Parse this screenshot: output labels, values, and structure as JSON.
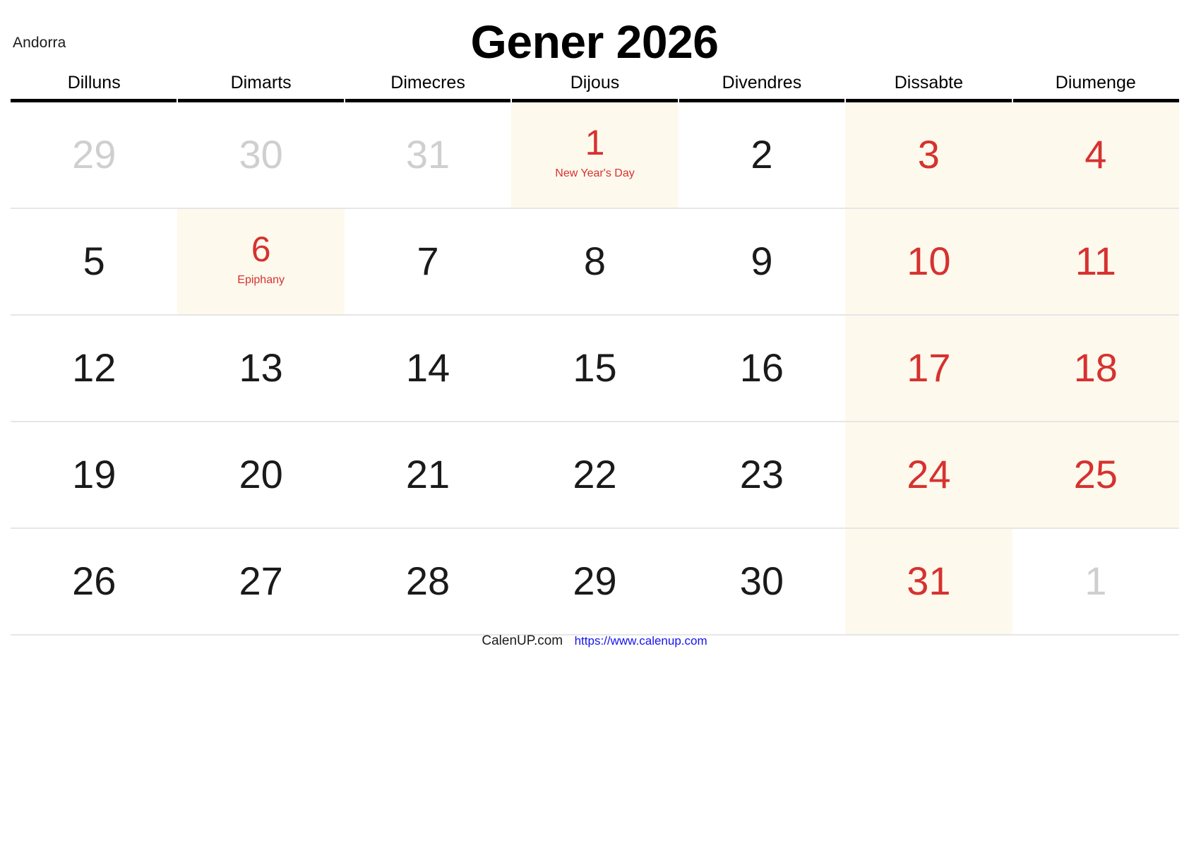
{
  "header": {
    "country": "Andorra",
    "title": "Gener 2026"
  },
  "weekdays": [
    "Dilluns",
    "Dimarts",
    "Dimecres",
    "Dijous",
    "Divendres",
    "Dissabte",
    "Diumenge"
  ],
  "colors": {
    "holiday_text": "#d63230",
    "weekend_background": "#fdf9ed",
    "muted_day": "#cfcfcf",
    "link": "#1414ee",
    "header_rule": "#000000",
    "row_rule": "#e6e6e6"
  },
  "weeks": [
    [
      {
        "num": "29",
        "style": "muted",
        "bg": "none",
        "event": ""
      },
      {
        "num": "30",
        "style": "muted",
        "bg": "none",
        "event": ""
      },
      {
        "num": "31",
        "style": "muted",
        "bg": "none",
        "event": ""
      },
      {
        "num": "1",
        "style": "red",
        "bg": "holiday",
        "event": "New Year's Day"
      },
      {
        "num": "2",
        "style": "normal",
        "bg": "none",
        "event": ""
      },
      {
        "num": "3",
        "style": "red",
        "bg": "weekend",
        "event": ""
      },
      {
        "num": "4",
        "style": "red",
        "bg": "weekend",
        "event": ""
      }
    ],
    [
      {
        "num": "5",
        "style": "normal",
        "bg": "none",
        "event": ""
      },
      {
        "num": "6",
        "style": "red",
        "bg": "holiday",
        "event": "Epiphany"
      },
      {
        "num": "7",
        "style": "normal",
        "bg": "none",
        "event": ""
      },
      {
        "num": "8",
        "style": "normal",
        "bg": "none",
        "event": ""
      },
      {
        "num": "9",
        "style": "normal",
        "bg": "none",
        "event": ""
      },
      {
        "num": "10",
        "style": "red",
        "bg": "weekend",
        "event": ""
      },
      {
        "num": "11",
        "style": "red",
        "bg": "weekend",
        "event": ""
      }
    ],
    [
      {
        "num": "12",
        "style": "normal",
        "bg": "none",
        "event": ""
      },
      {
        "num": "13",
        "style": "normal",
        "bg": "none",
        "event": ""
      },
      {
        "num": "14",
        "style": "normal",
        "bg": "none",
        "event": ""
      },
      {
        "num": "15",
        "style": "normal",
        "bg": "none",
        "event": ""
      },
      {
        "num": "16",
        "style": "normal",
        "bg": "none",
        "event": ""
      },
      {
        "num": "17",
        "style": "red",
        "bg": "weekend",
        "event": ""
      },
      {
        "num": "18",
        "style": "red",
        "bg": "weekend",
        "event": ""
      }
    ],
    [
      {
        "num": "19",
        "style": "normal",
        "bg": "none",
        "event": ""
      },
      {
        "num": "20",
        "style": "normal",
        "bg": "none",
        "event": ""
      },
      {
        "num": "21",
        "style": "normal",
        "bg": "none",
        "event": ""
      },
      {
        "num": "22",
        "style": "normal",
        "bg": "none",
        "event": ""
      },
      {
        "num": "23",
        "style": "normal",
        "bg": "none",
        "event": ""
      },
      {
        "num": "24",
        "style": "red",
        "bg": "weekend",
        "event": ""
      },
      {
        "num": "25",
        "style": "red",
        "bg": "weekend",
        "event": ""
      }
    ],
    [
      {
        "num": "26",
        "style": "normal",
        "bg": "none",
        "event": ""
      },
      {
        "num": "27",
        "style": "normal",
        "bg": "none",
        "event": ""
      },
      {
        "num": "28",
        "style": "normal",
        "bg": "none",
        "event": ""
      },
      {
        "num": "29",
        "style": "normal",
        "bg": "none",
        "event": ""
      },
      {
        "num": "30",
        "style": "normal",
        "bg": "none",
        "event": ""
      },
      {
        "num": "31",
        "style": "red",
        "bg": "weekend",
        "event": ""
      },
      {
        "num": "1",
        "style": "muted",
        "bg": "none",
        "event": ""
      }
    ]
  ],
  "footer": {
    "brand": "CalenUP.com",
    "url": "https://www.calenup.com"
  }
}
